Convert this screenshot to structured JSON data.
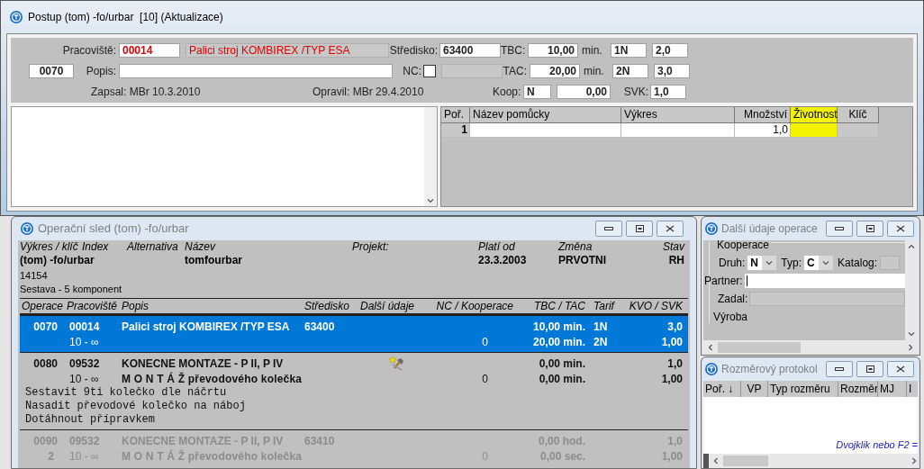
{
  "window": {
    "title": "Postup (tom) -fo/urbar  [10] (Aktualizace)"
  },
  "form": {
    "pracoviste": {
      "label": "Pracoviště:",
      "code": "00014",
      "name": "Palici stroj KOMBIREX /TYP ESA"
    },
    "stredisko": {
      "label": "Středisko:",
      "value": "63400"
    },
    "tbc": {
      "label": "TBC:",
      "value": "10,00",
      "unit": "min.",
      "tarif": "1N",
      "kvo": "2,0"
    },
    "operation": "0070",
    "popis": {
      "label": "Popis:"
    },
    "nc": {
      "label": "NC:",
      "checked": false
    },
    "tac": {
      "label": "TAC:",
      "value": "20,00",
      "unit": "min.",
      "tarif": "2N",
      "kvo": "3,0"
    },
    "zapsal": "Zapsal: MBr 10.3.2010",
    "opravil": "Opravil: MBr 29.4.2010",
    "koop": {
      "label": "Koop:",
      "value": "N",
      "amount": "0,00"
    },
    "svk": {
      "label": "SVK:",
      "value": "1,0"
    }
  },
  "tools": {
    "columns": [
      {
        "label": "Poř.",
        "highlighted": false
      },
      {
        "label": "Název pomůcky",
        "highlighted": false
      },
      {
        "label": "Výkres",
        "highlighted": false
      },
      {
        "label": "Množství",
        "highlighted": false
      },
      {
        "label": "Životnost",
        "highlighted": true
      },
      {
        "label": "Klíč",
        "highlighted": false
      }
    ],
    "rows": [
      {
        "por": "1",
        "mnozstvi": "1,0"
      }
    ]
  },
  "operations": {
    "title": "Operační sled (tom) -fo/urbar",
    "summary": [
      {
        "label": "Výkres / klíč",
        "value": "(tom) -fo/urbar"
      },
      {
        "label": "Index"
      },
      {
        "label": "Alternativa"
      },
      {
        "label": "Název",
        "value": "tomfourbar"
      },
      {
        "label": "Projekt:"
      },
      {
        "label": "Platí od",
        "value": "23.3.2003"
      },
      {
        "label": "Změna",
        "value": "PRVOTNI"
      },
      {
        "label": "Stav",
        "value": "RH"
      }
    ],
    "drawing_number": "14154",
    "assembly": "Sestava - 5 komponent",
    "columns": [
      "Operace",
      "Pracoviště",
      "Popis",
      "Středisko",
      "Další údaje",
      "NC / Kooperace",
      "TBC / TAC",
      "Tarif",
      "KVO / SVK"
    ],
    "rows": [
      {
        "operace": "0070",
        "pracoviste": "00014",
        "popis": "Palici stroj KOMBIREX /TYP ESA",
        "stredisko": "63400",
        "range": "10 - ∞",
        "nc": "0",
        "tbc": "10,00 min.",
        "tac": "20,00 min.",
        "tarif1": "1N",
        "tarif2": "2N",
        "kvo": "3,0",
        "svk": "1,00",
        "notes": [],
        "selected": true,
        "disabled": false,
        "tool_icon": false
      },
      {
        "operace": "0080",
        "pracoviste": "09532",
        "popis": "KONECNE MONTAZE - P II, P IV",
        "range": "10 - ∞",
        "popis2": "M O N T Á Ž převodového kolečka",
        "nc": "0",
        "tbc": "0,00 min.",
        "tac": "0,00 min.",
        "kvo": "1,0",
        "svk": "1,00",
        "notes": [
          "Sestavit 9ti kolečko dle náčrtu",
          "Nasadit převodové kolečko na náboj",
          "Dotáhnout přípravkem"
        ],
        "selected": false,
        "disabled": false,
        "tool_icon": true
      },
      {
        "operace": "0090",
        "pracoviste": "09532",
        "popis": "KONECNE MONTAZE - P II, P IV",
        "stredisko": "63410",
        "index": "2",
        "range": "10 - ∞",
        "popis2": "M O N T Á Ž převodového kolečka",
        "nc": "0",
        "tbc": "0,00 hod.",
        "tac": "0,00 sec.",
        "kvo": "1,0",
        "svk": "1,00",
        "notes": [],
        "selected": false,
        "disabled": true,
        "tool_icon": false
      }
    ]
  },
  "details": {
    "title": "Další údaje operace",
    "group": "Kooperace",
    "druh": {
      "label": "Druh:",
      "value": "N"
    },
    "typ": {
      "label": "Typ:",
      "value": "C"
    },
    "katalog": {
      "label": "Katalog:"
    },
    "partner": {
      "label": "Partner:"
    },
    "zadal": {
      "label": "Zadal:"
    },
    "group2": "Výroba"
  },
  "protocol": {
    "title": "Rozměrový protokol",
    "columns": [
      "Poř. ↓",
      "VP",
      "Typ rozměru",
      "Rozměr",
      "MJ",
      "I"
    ],
    "hint": "Dvojklik nebo F2 ="
  }
}
